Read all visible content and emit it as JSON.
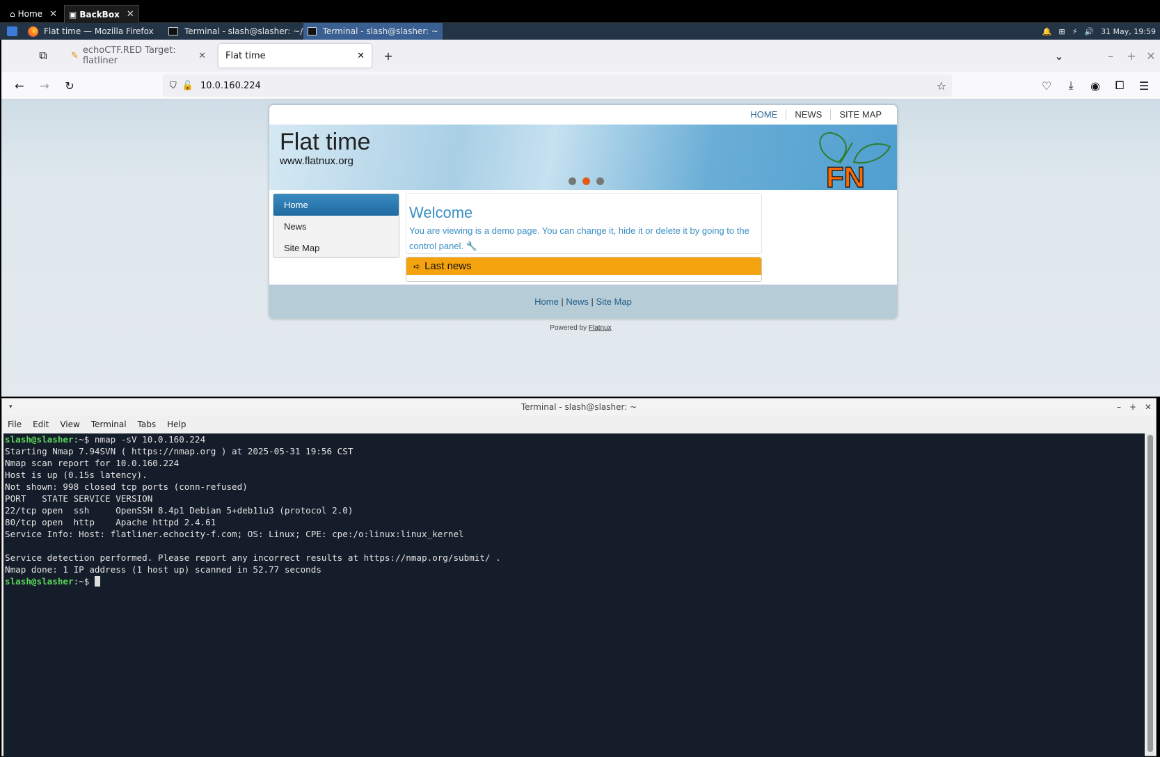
{
  "viewer_tabs": [
    {
      "label": "Home",
      "active": false
    },
    {
      "label": "BackBox",
      "active": true
    }
  ],
  "taskbar": {
    "tasks": [
      {
        "label": "Flat time — Mozilla Firefox",
        "active": false
      },
      {
        "label": "Terminal - slash@slasher: ~/...",
        "active": false
      },
      {
        "label": "Terminal - slash@slasher: ~",
        "active": true
      }
    ],
    "clock": "31 May, 19:59"
  },
  "browser": {
    "tabs": [
      {
        "label": "echoCTF.RED Target: flatliner",
        "active": false
      },
      {
        "label": "Flat time",
        "active": true
      }
    ],
    "url": "10.0.160.224"
  },
  "site": {
    "nav": [
      "HOME",
      "NEWS",
      "SITE MAP"
    ],
    "title": "Flat time",
    "subtitle": "www.flatnux.org",
    "logo_text": "FN",
    "menu": [
      "Home",
      "News",
      "Site Map"
    ],
    "welcome_title": "Welcome",
    "welcome_text": "You are viewing is a demo page. You can change it, hide it or delete it by going to the control panel.",
    "last_news": "Last news",
    "footer_links": [
      "Home",
      "News",
      "Site Map"
    ],
    "powered_by": "Powered by",
    "powered_link": "Flatnux"
  },
  "terminal": {
    "title": "Terminal - slash@slasher: ~",
    "menu": [
      "File",
      "Edit",
      "View",
      "Terminal",
      "Tabs",
      "Help"
    ],
    "prompt_user": "slash@slasher",
    "prompt_rest": ":~$ ",
    "command": "nmap -sV 10.0.160.224",
    "output": [
      "Starting Nmap 7.94SVN ( https://nmap.org ) at 2025-05-31 19:56 CST",
      "Nmap scan report for 10.0.160.224",
      "Host is up (0.15s latency).",
      "Not shown: 998 closed tcp ports (conn-refused)",
      "PORT   STATE SERVICE VERSION",
      "22/tcp open  ssh     OpenSSH 8.4p1 Debian 5+deb11u3 (protocol 2.0)",
      "80/tcp open  http    Apache httpd 2.4.61",
      "Service Info: Host: flatliner.echocity-f.com; OS: Linux; CPE: cpe:/o:linux:linux_kernel",
      "",
      "Service detection performed. Please report any incorrect results at https://nmap.org/submit/ .",
      "Nmap done: 1 IP address (1 host up) scanned in 52.77 seconds"
    ]
  }
}
